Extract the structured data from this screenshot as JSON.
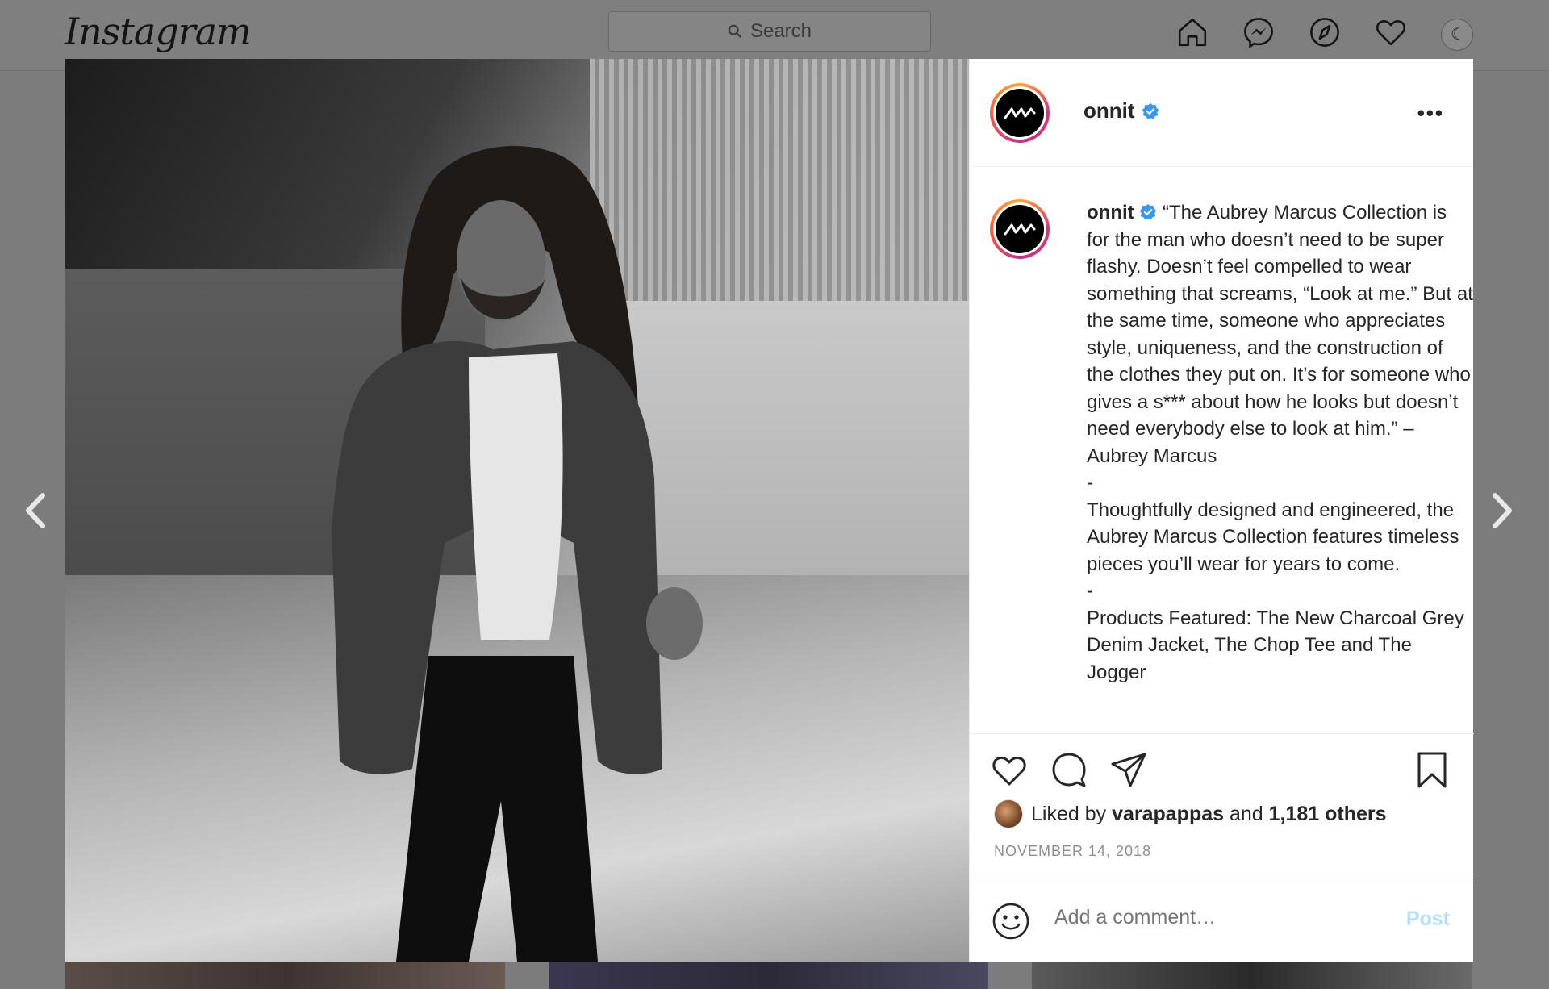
{
  "nav": {
    "logo": "Instagram",
    "search_placeholder": "Search",
    "icons": [
      "home-icon",
      "messenger-icon",
      "explore-icon",
      "heart-icon",
      "profile-avatar"
    ]
  },
  "post": {
    "username": "onnit",
    "verified": true,
    "more_label": "•••",
    "caption_user": "onnit",
    "caption_text": " “The Aubrey Marcus Collection is for the man who doesn’t need to be super flashy. Doesn’t feel compelled to wear something that screams, “Look at me.” But at the same time, someone who appreciates style, uniqueness, and the construction of the clothes they put on. It’s for someone who gives a s*** about how he looks but doesn’t need everybody else to look at him.” – Aubrey Marcus\n-\nThoughtfully designed and engineered, the Aubrey Marcus Collection features timeless pieces you’ll wear for years to come.\n-\nProducts Featured: The New Charcoal Grey Denim Jacket, The Chop Tee and The Jogger",
    "liked_prefix": "Liked by ",
    "liked_user": "varapappas",
    "liked_mid": " and ",
    "liked_count": "1,181 others",
    "date": "NOVEMBER 14, 2018",
    "comment_placeholder": "Add a comment…",
    "post_button": "Post"
  },
  "colors": {
    "accent": "#0095f6",
    "post_disabled": "#b2dffc",
    "verified": "#3897f0"
  }
}
